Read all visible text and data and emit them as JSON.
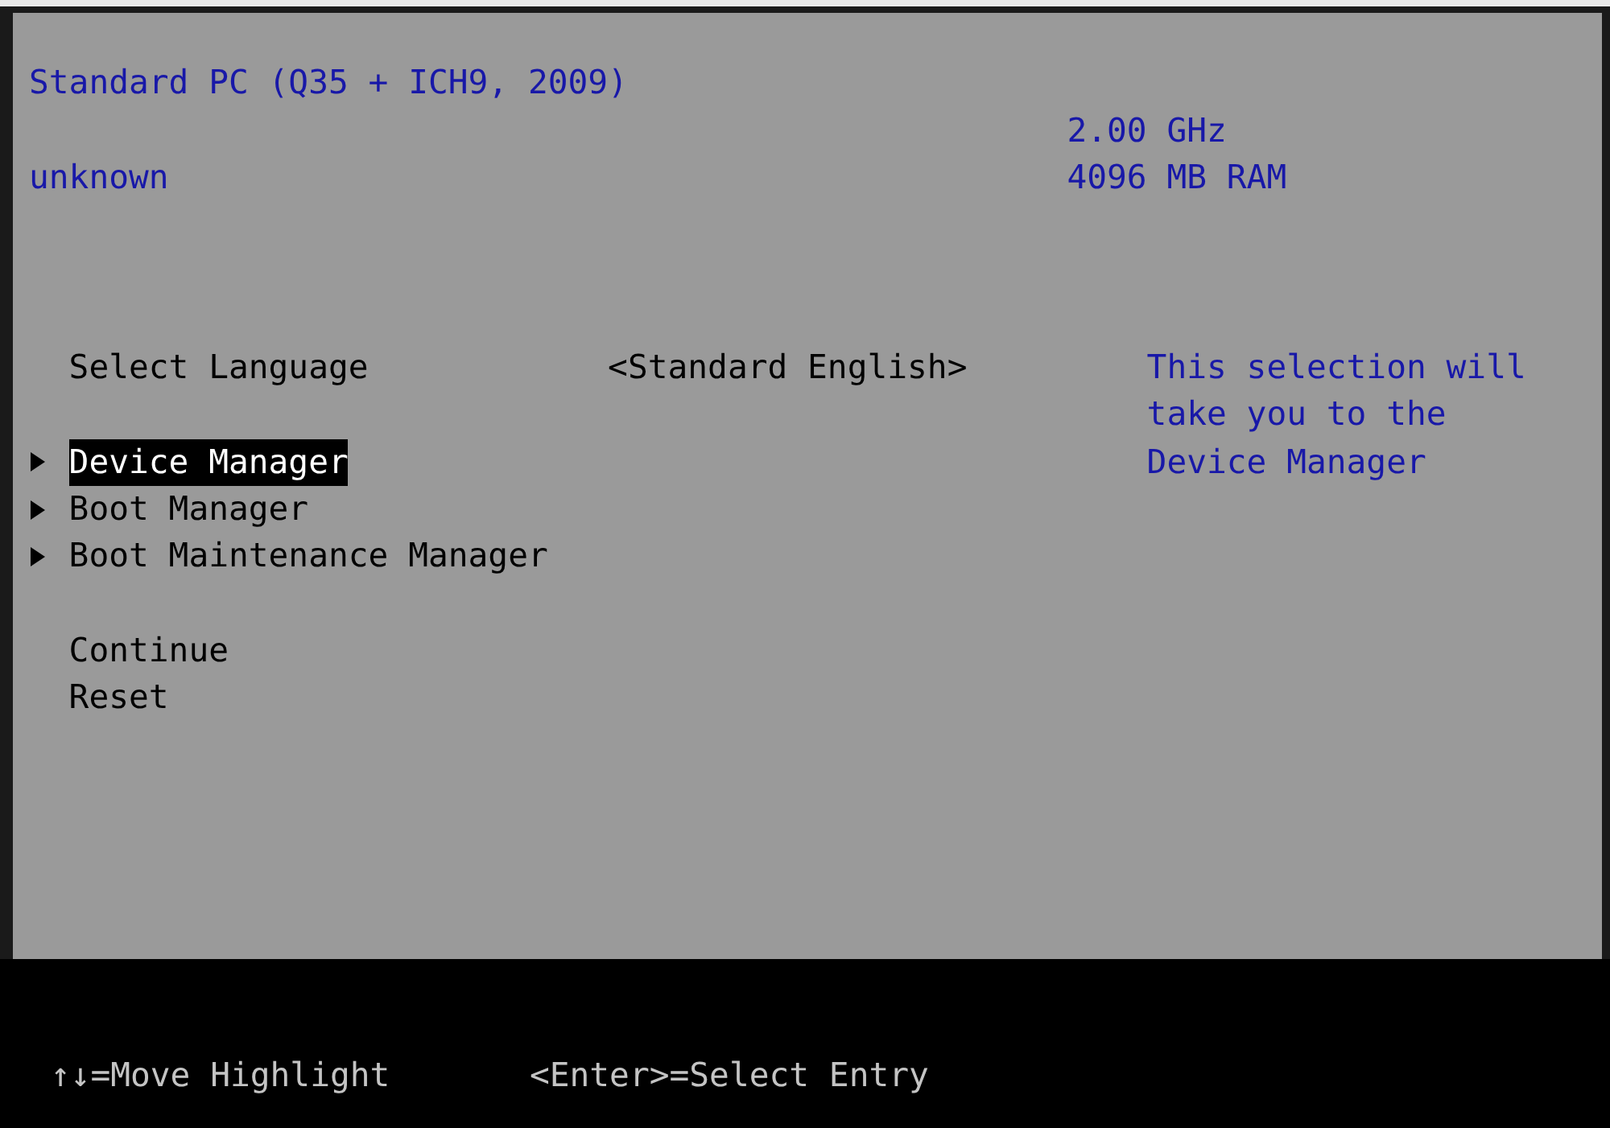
{
  "header": {
    "title": "Standard PC (Q35 + ICH9, 2009)",
    "subtitle": "unknown",
    "cpu_speed": "2.00 GHz",
    "memory": "4096 MB RAM"
  },
  "language": {
    "label": "Select Language",
    "value": "<Standard English>"
  },
  "menu": [
    {
      "label": "Device Manager",
      "kind": "submenu",
      "selected": true
    },
    {
      "label": "Boot Manager",
      "kind": "submenu",
      "selected": false
    },
    {
      "label": "Boot Maintenance Manager",
      "kind": "submenu",
      "selected": false
    },
    {
      "label": "Continue",
      "kind": "action",
      "selected": false
    },
    {
      "label": "Reset",
      "kind": "action",
      "selected": false
    }
  ],
  "help_text": "This selection will take you to the Device Manager",
  "footer": {
    "hints": [
      "↑↓=Move Highlight",
      "<Enter>=Select Entry"
    ]
  }
}
